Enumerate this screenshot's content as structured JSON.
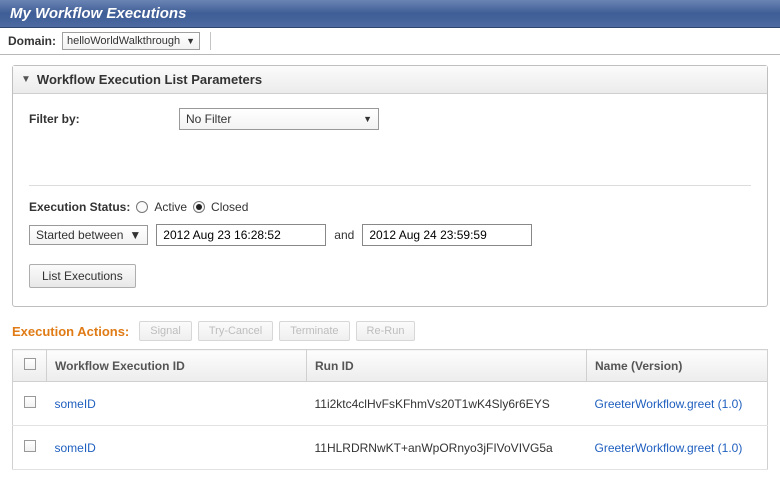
{
  "title": "My Workflow Executions",
  "domain": {
    "label": "Domain:",
    "value": "helloWorldWalkthrough"
  },
  "panel": {
    "title": "Workflow Execution List Parameters",
    "filter": {
      "label": "Filter by:",
      "value": "No Filter"
    },
    "status": {
      "label": "Execution Status:",
      "options": {
        "active": "Active",
        "closed": "Closed"
      }
    },
    "dateRange": {
      "mode": "Started between",
      "from": "2012 Aug 23 16:28:52",
      "and": "and",
      "to": "2012 Aug 24 23:59:59"
    },
    "listButton": "List Executions"
  },
  "actions": {
    "title": "Execution Actions:",
    "buttons": [
      "Signal",
      "Try-Cancel",
      "Terminate",
      "Re-Run"
    ]
  },
  "table": {
    "headers": {
      "wfid": "Workflow Execution ID",
      "runid": "Run ID",
      "name": "Name (Version)"
    },
    "rows": [
      {
        "wfid": "someID",
        "runid": "11i2ktc4clHvFsKFhmVs20T1wK4Sly6r6EYS",
        "name": "GreeterWorkflow.greet (1.0)"
      },
      {
        "wfid": "someID",
        "runid": "11HLRDRNwKT+anWpORnyo3jFIVoVIVG5a",
        "name": "GreeterWorkflow.greet (1.0)"
      }
    ]
  }
}
